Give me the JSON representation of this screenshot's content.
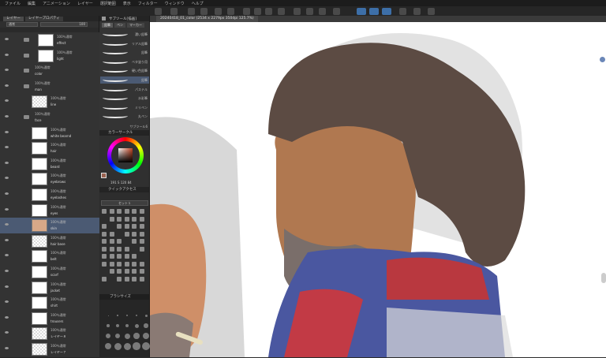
{
  "menu": [
    "ファイル",
    "編集",
    "アニメーション",
    "レイヤー",
    "選択範囲",
    "表示",
    "フィルター",
    "ウィンドウ",
    "ヘルプ"
  ],
  "layer_panel": {
    "tabs": [
      "レイヤー",
      "レイヤープロパティ"
    ],
    "blend": "通常",
    "opacity": "100",
    "layers": [
      {
        "mode": "100％通常",
        "name": "effect",
        "thumb": "white",
        "folder": true
      },
      {
        "mode": "100％通常",
        "name": "light",
        "thumb": "white",
        "folder": true
      },
      {
        "mode": "100％通常",
        "name": "color",
        "thumb": "none",
        "folder": true
      },
      {
        "mode": "100％通常",
        "name": "man",
        "thumb": "none",
        "folder": true
      },
      {
        "mode": "100％通常",
        "name": "line",
        "thumb": "checker",
        "folder": false
      },
      {
        "mode": "100％通常",
        "name": "face",
        "thumb": "none",
        "folder": true
      },
      {
        "mode": "100％通常",
        "name": "white bearnd",
        "thumb": "white",
        "folder": false
      },
      {
        "mode": "100％通常",
        "name": "hair",
        "thumb": "white",
        "folder": false
      },
      {
        "mode": "100％通常",
        "name": "beard",
        "thumb": "white",
        "folder": false
      },
      {
        "mode": "100％通常",
        "name": "eyebrows",
        "thumb": "white",
        "folder": false
      },
      {
        "mode": "100％通常",
        "name": "eyelashes",
        "thumb": "white",
        "folder": false
      },
      {
        "mode": "100％通常",
        "name": "eyes",
        "thumb": "white",
        "folder": false
      },
      {
        "mode": "100％通常",
        "name": "skin",
        "thumb": "skin",
        "folder": false,
        "selected": true
      },
      {
        "mode": "100％通常",
        "name": "hair base",
        "thumb": "checker",
        "folder": false
      },
      {
        "mode": "100％通常",
        "name": "belt",
        "thumb": "white",
        "folder": false
      },
      {
        "mode": "100％通常",
        "name": "scarf",
        "thumb": "white",
        "folder": false
      },
      {
        "mode": "100％通常",
        "name": "jacket",
        "thumb": "white",
        "folder": false
      },
      {
        "mode": "100％通常",
        "name": "shirt",
        "thumb": "white",
        "folder": false
      },
      {
        "mode": "100％通常",
        "name": "trousers",
        "thumb": "white",
        "folder": false
      },
      {
        "mode": "100％通常",
        "name": "レイヤー８",
        "thumb": "checker",
        "folder": false
      },
      {
        "mode": "100％通常",
        "name": "レイヤー７",
        "thumb": "checker",
        "folder": false
      }
    ]
  },
  "subtool_panel": {
    "header": "サブツール[描画]",
    "tabs": [
      "鉛筆",
      "ペン",
      "マーカー"
    ],
    "brushes": [
      "濃い鉛筆",
      "リアル鉛筆",
      "鉛筆",
      "ベタ塗り用",
      "硬い色鉛筆",
      "鉛筆",
      "パステル",
      "水彩筆",
      "ミリペン",
      "丸ペン"
    ],
    "selected_brush": "サブツール6"
  },
  "color_panel": {
    "header": "カラーサークル",
    "readout": "191  S  120   84",
    "fg_color": "#9a6250"
  },
  "quick_panel": {
    "header": "クイックアクセス",
    "set": "セット１"
  },
  "size_panel": {
    "header": "ブラシサイズ"
  },
  "canvas": {
    "tab": "20240418_01_color (2534 x 2279px 350dpi 125.7%)"
  }
}
